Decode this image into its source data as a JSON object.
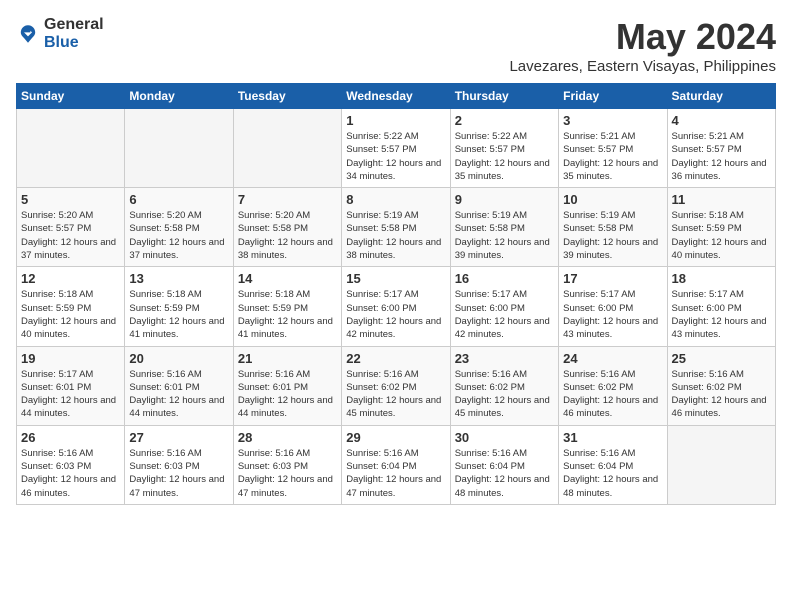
{
  "header": {
    "logo_general": "General",
    "logo_blue": "Blue",
    "month_title": "May 2024",
    "subtitle": "Lavezares, Eastern Visayas, Philippines"
  },
  "weekdays": [
    "Sunday",
    "Monday",
    "Tuesday",
    "Wednesday",
    "Thursday",
    "Friday",
    "Saturday"
  ],
  "weeks": [
    [
      {
        "day": "",
        "empty": true
      },
      {
        "day": "",
        "empty": true
      },
      {
        "day": "",
        "empty": true
      },
      {
        "day": "1",
        "sunrise": "5:22 AM",
        "sunset": "5:57 PM",
        "daylight": "12 hours and 34 minutes."
      },
      {
        "day": "2",
        "sunrise": "5:22 AM",
        "sunset": "5:57 PM",
        "daylight": "12 hours and 35 minutes."
      },
      {
        "day": "3",
        "sunrise": "5:21 AM",
        "sunset": "5:57 PM",
        "daylight": "12 hours and 35 minutes."
      },
      {
        "day": "4",
        "sunrise": "5:21 AM",
        "sunset": "5:57 PM",
        "daylight": "12 hours and 36 minutes."
      }
    ],
    [
      {
        "day": "5",
        "sunrise": "5:20 AM",
        "sunset": "5:57 PM",
        "daylight": "12 hours and 37 minutes."
      },
      {
        "day": "6",
        "sunrise": "5:20 AM",
        "sunset": "5:58 PM",
        "daylight": "12 hours and 37 minutes."
      },
      {
        "day": "7",
        "sunrise": "5:20 AM",
        "sunset": "5:58 PM",
        "daylight": "12 hours and 38 minutes."
      },
      {
        "day": "8",
        "sunrise": "5:19 AM",
        "sunset": "5:58 PM",
        "daylight": "12 hours and 38 minutes."
      },
      {
        "day": "9",
        "sunrise": "5:19 AM",
        "sunset": "5:58 PM",
        "daylight": "12 hours and 39 minutes."
      },
      {
        "day": "10",
        "sunrise": "5:19 AM",
        "sunset": "5:58 PM",
        "daylight": "12 hours and 39 minutes."
      },
      {
        "day": "11",
        "sunrise": "5:18 AM",
        "sunset": "5:59 PM",
        "daylight": "12 hours and 40 minutes."
      }
    ],
    [
      {
        "day": "12",
        "sunrise": "5:18 AM",
        "sunset": "5:59 PM",
        "daylight": "12 hours and 40 minutes."
      },
      {
        "day": "13",
        "sunrise": "5:18 AM",
        "sunset": "5:59 PM",
        "daylight": "12 hours and 41 minutes."
      },
      {
        "day": "14",
        "sunrise": "5:18 AM",
        "sunset": "5:59 PM",
        "daylight": "12 hours and 41 minutes."
      },
      {
        "day": "15",
        "sunrise": "5:17 AM",
        "sunset": "6:00 PM",
        "daylight": "12 hours and 42 minutes."
      },
      {
        "day": "16",
        "sunrise": "5:17 AM",
        "sunset": "6:00 PM",
        "daylight": "12 hours and 42 minutes."
      },
      {
        "day": "17",
        "sunrise": "5:17 AM",
        "sunset": "6:00 PM",
        "daylight": "12 hours and 43 minutes."
      },
      {
        "day": "18",
        "sunrise": "5:17 AM",
        "sunset": "6:00 PM",
        "daylight": "12 hours and 43 minutes."
      }
    ],
    [
      {
        "day": "19",
        "sunrise": "5:17 AM",
        "sunset": "6:01 PM",
        "daylight": "12 hours and 44 minutes."
      },
      {
        "day": "20",
        "sunrise": "5:16 AM",
        "sunset": "6:01 PM",
        "daylight": "12 hours and 44 minutes."
      },
      {
        "day": "21",
        "sunrise": "5:16 AM",
        "sunset": "6:01 PM",
        "daylight": "12 hours and 44 minutes."
      },
      {
        "day": "22",
        "sunrise": "5:16 AM",
        "sunset": "6:02 PM",
        "daylight": "12 hours and 45 minutes."
      },
      {
        "day": "23",
        "sunrise": "5:16 AM",
        "sunset": "6:02 PM",
        "daylight": "12 hours and 45 minutes."
      },
      {
        "day": "24",
        "sunrise": "5:16 AM",
        "sunset": "6:02 PM",
        "daylight": "12 hours and 46 minutes."
      },
      {
        "day": "25",
        "sunrise": "5:16 AM",
        "sunset": "6:02 PM",
        "daylight": "12 hours and 46 minutes."
      }
    ],
    [
      {
        "day": "26",
        "sunrise": "5:16 AM",
        "sunset": "6:03 PM",
        "daylight": "12 hours and 46 minutes."
      },
      {
        "day": "27",
        "sunrise": "5:16 AM",
        "sunset": "6:03 PM",
        "daylight": "12 hours and 47 minutes."
      },
      {
        "day": "28",
        "sunrise": "5:16 AM",
        "sunset": "6:03 PM",
        "daylight": "12 hours and 47 minutes."
      },
      {
        "day": "29",
        "sunrise": "5:16 AM",
        "sunset": "6:04 PM",
        "daylight": "12 hours and 47 minutes."
      },
      {
        "day": "30",
        "sunrise": "5:16 AM",
        "sunset": "6:04 PM",
        "daylight": "12 hours and 48 minutes."
      },
      {
        "day": "31",
        "sunrise": "5:16 AM",
        "sunset": "6:04 PM",
        "daylight": "12 hours and 48 minutes."
      },
      {
        "day": "",
        "empty": true
      }
    ]
  ]
}
